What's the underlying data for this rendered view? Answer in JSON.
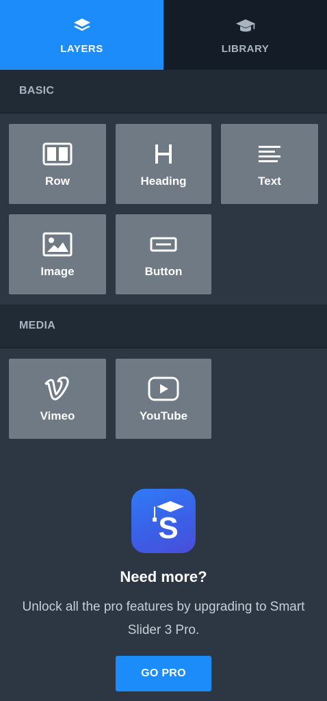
{
  "tabs": [
    {
      "label": "LAYERS",
      "icon": "layers-icon",
      "active": true
    },
    {
      "label": "LIBRARY",
      "icon": "graduation-cap-icon",
      "active": false
    }
  ],
  "sections": {
    "basic": {
      "title": "BASIC",
      "items": [
        {
          "label": "Row",
          "icon": "row-icon"
        },
        {
          "label": "Heading",
          "icon": "heading-icon"
        },
        {
          "label": "Text",
          "icon": "text-icon"
        },
        {
          "label": "Image",
          "icon": "image-icon"
        },
        {
          "label": "Button",
          "icon": "button-icon"
        }
      ]
    },
    "media": {
      "title": "MEDIA",
      "items": [
        {
          "label": "Vimeo",
          "icon": "vimeo-icon"
        },
        {
          "label": "YouTube",
          "icon": "youtube-icon"
        }
      ]
    }
  },
  "promo": {
    "logo_letter": "S",
    "title": "Need more?",
    "text": "Unlock all the pro features by upgrading to Smart Slider 3 Pro.",
    "button_label": "GO PRO"
  },
  "colors": {
    "accent": "#1b8cf9",
    "background": "#2c3743",
    "section_header": "#212b35",
    "tile": "#6f7a85",
    "tab_inactive": "#141d27"
  }
}
